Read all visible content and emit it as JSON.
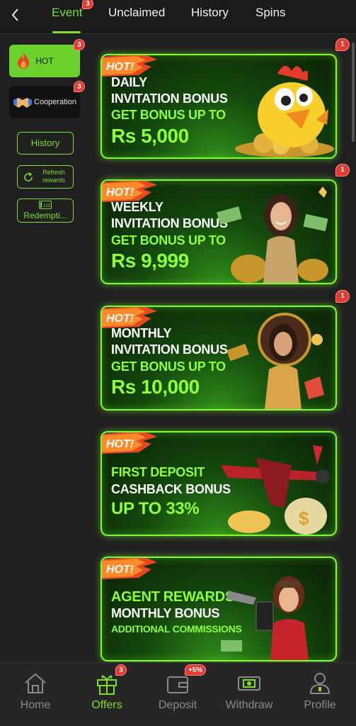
{
  "header": {
    "tabs": [
      {
        "label": "Event",
        "badge": "3",
        "active": true
      },
      {
        "label": "Unclaimed"
      },
      {
        "label": "History"
      },
      {
        "label": "Spins"
      }
    ]
  },
  "sidebar": {
    "hot": {
      "label": "HOT",
      "badge": "3"
    },
    "cooperation": {
      "label": "Cooperation",
      "badge": "3"
    },
    "history_label": "History",
    "refresh_label": "Refresh rewards",
    "redemption_label": "Redempti...",
    "redemption_icon_text": "123"
  },
  "banners": [
    {
      "hot": "HOT!",
      "line1": "DAILY",
      "line2": "INVITATION BONUS",
      "line3": "GET BONUS UP TO",
      "amount": "Rs 5,000",
      "badge": "1"
    },
    {
      "hot": "HOT!",
      "line1": "WEEKLY",
      "line2": "INVITATION BONUS",
      "line3": "GET BONUS UP TO",
      "amount": "Rs 9,999",
      "badge": "1"
    },
    {
      "hot": "HOT!",
      "line1": "MONTHLY",
      "line2": "INVITATION BONUS",
      "line3": "GET BONUS UP TO",
      "amount": "Rs 10,000",
      "badge": "1"
    },
    {
      "hot": "HOT!",
      "line1": "FIRST DEPOSIT",
      "line2": "CASHBACK BONUS",
      "line3": "UP TO 33%"
    },
    {
      "hot": "HOT!",
      "line1": "AGENT REWARDS",
      "line2": "MONTHLY BONUS",
      "line3": "ADDITIONAL COMMISSIONS"
    }
  ],
  "bottom_nav": [
    {
      "label": "Home",
      "icon": "home-icon"
    },
    {
      "label": "Offers",
      "icon": "gift-icon",
      "badge": "3",
      "active": true
    },
    {
      "label": "Deposit",
      "icon": "wallet-icon",
      "badge": "+5%"
    },
    {
      "label": "Withdraw",
      "icon": "cash-icon"
    },
    {
      "label": "Profile",
      "icon": "profile-icon"
    }
  ],
  "colors": {
    "accent": "#7edc2d",
    "badge": "#e23b34",
    "background": "#202020"
  }
}
